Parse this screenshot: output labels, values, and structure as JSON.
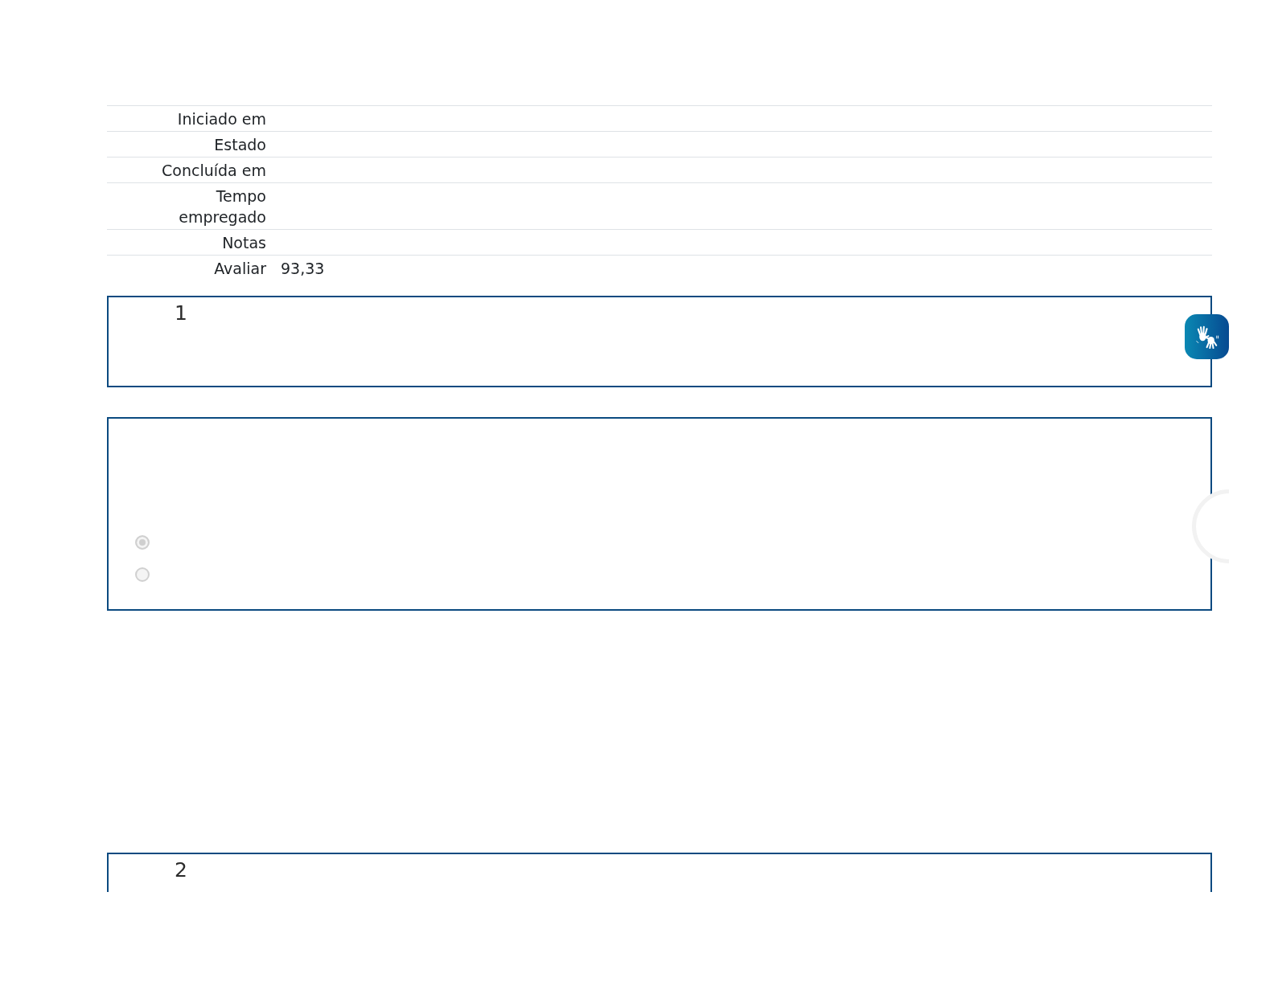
{
  "summary": {
    "rows": [
      {
        "label": "Iniciado em"
      },
      {
        "label": "Estado"
      },
      {
        "label": "Concluída em"
      },
      {
        "label": "Tempo empregado"
      },
      {
        "label": "Notas"
      },
      {
        "label": "Avaliar",
        "value": "93,33"
      }
    ]
  },
  "questions": [
    {
      "number": "1",
      "options": [
        {
          "selected": true,
          "disabled": true
        },
        {
          "selected": false,
          "disabled": true
        }
      ]
    },
    {
      "number": "2"
    }
  ]
}
